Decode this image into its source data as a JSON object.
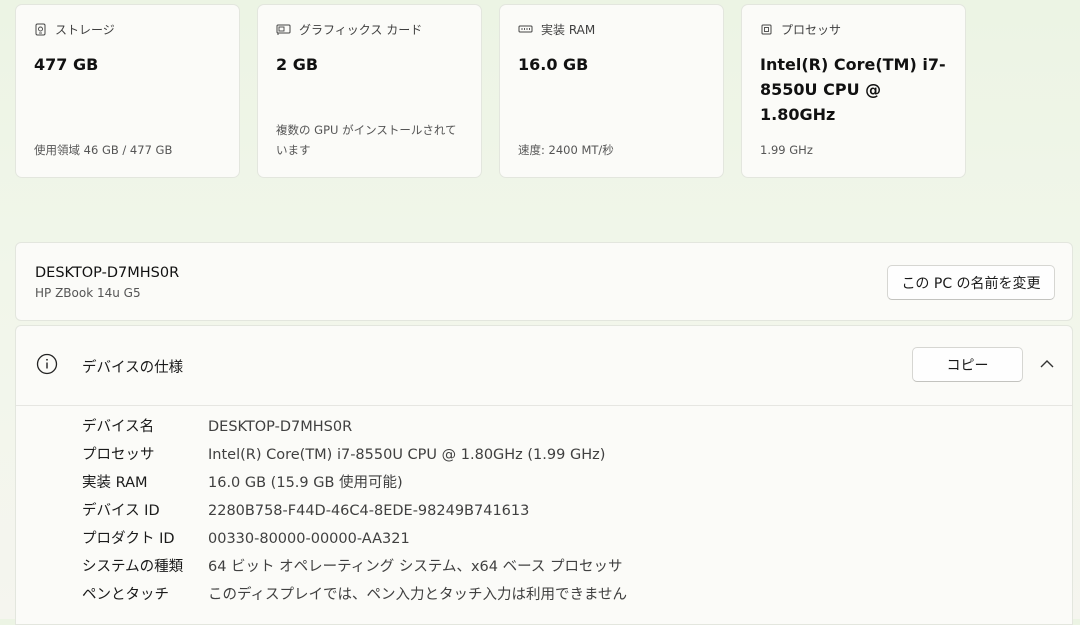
{
  "cards": [
    {
      "icon": "storage-icon",
      "title": "ストレージ",
      "value": "477 GB",
      "sub": "使用領域 46 GB / 477 GB"
    },
    {
      "icon": "graphics-card-icon",
      "title": "グラフィックス カード",
      "value": "2 GB",
      "sub": "複数の GPU がインストールされています"
    },
    {
      "icon": "ram-icon",
      "title": "実装 RAM",
      "value": "16.0 GB",
      "sub": "速度: 2400 MT/秒"
    },
    {
      "icon": "processor-icon",
      "title": "プロセッサ",
      "value": "Intel(R) Core(TM) i7-8550U CPU @ 1.80GHz",
      "sub": "1.99 GHz"
    }
  ],
  "pc": {
    "name": "DESKTOP-D7MHS0R",
    "model": "HP ZBook 14u G5",
    "rename_label": "この PC の名前を変更"
  },
  "specs": {
    "title": "デバイスの仕様",
    "copy_label": "コピー",
    "rows": [
      {
        "key": "デバイス名",
        "value": "DESKTOP-D7MHS0R"
      },
      {
        "key": "プロセッサ",
        "value": "Intel(R) Core(TM) i7-8550U CPU @ 1.80GHz (1.99 GHz)"
      },
      {
        "key": "実装 RAM",
        "value": "16.0 GB (15.9 GB 使用可能)"
      },
      {
        "key": "デバイス ID",
        "value": "2280B758-F44D-46C4-8EDE-98249B741613"
      },
      {
        "key": "プロダクト ID",
        "value": "00330-80000-00000-AA321"
      },
      {
        "key": "システムの種類",
        "value": "64 ビット オペレーティング システム、x64 ベース プロセッサ"
      },
      {
        "key": "ペンとタッチ",
        "value": "このディスプレイでは、ペン入力とタッチ入力は利用できません"
      }
    ]
  }
}
